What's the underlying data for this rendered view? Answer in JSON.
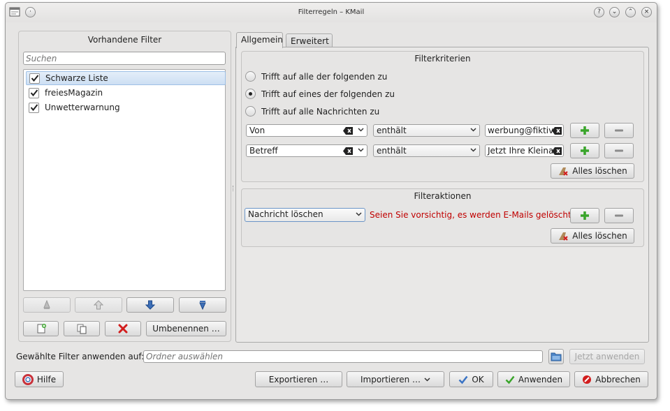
{
  "window": {
    "title": "Filterregeln – KMail",
    "controls": [
      "help-icon",
      "minimize-icon",
      "maximize-icon",
      "close-icon"
    ]
  },
  "left": {
    "title": "Vorhandene Filter",
    "search_placeholder": "Suchen",
    "filters": [
      {
        "label": "Schwarze Liste",
        "checked": true,
        "selected": true
      },
      {
        "label": "freiesMagazin",
        "checked": true,
        "selected": false
      },
      {
        "label": "Unwetterwarnung",
        "checked": true,
        "selected": false
      }
    ],
    "rename_button": "Umbenennen …"
  },
  "tabs": [
    {
      "label": "Allgemein",
      "active": true
    },
    {
      "label": "Erweitert",
      "active": false
    }
  ],
  "criteria": {
    "title": "Filterkriterien",
    "options": [
      {
        "label": "Trifft auf alle der folgenden zu",
        "selected": false
      },
      {
        "label": "Trifft auf eines der folgenden zu",
        "selected": true
      },
      {
        "label": "Trifft auf alle Nachrichten zu",
        "selected": false
      }
    ],
    "rules": [
      {
        "field": "Von",
        "op": "enthält",
        "value": "werbung@fiktive"
      },
      {
        "field": "Betreff",
        "op": "enthält",
        "value": "Jetzt Ihre Kleinar"
      }
    ],
    "clear_all": "Alles löschen"
  },
  "actions": {
    "title": "Filteraktionen",
    "action": "Nachricht löschen",
    "warning": "Seien Sie vorsichtig, es werden E-Mails gelöscht.",
    "clear_all": "Alles löschen"
  },
  "apply": {
    "label": "Gewählte Filter anwenden auf:",
    "placeholder": "Ordner auswählen",
    "button": "Jetzt anwenden"
  },
  "footer": {
    "help": "Hilfe",
    "export": "Exportieren …",
    "import": "Importieren …",
    "ok": "OK",
    "apply": "Anwenden",
    "cancel": "Abbrechen"
  },
  "colors": {
    "warning": "#c00000",
    "selection": "#cddff3",
    "add_green": "#3aa52b"
  }
}
